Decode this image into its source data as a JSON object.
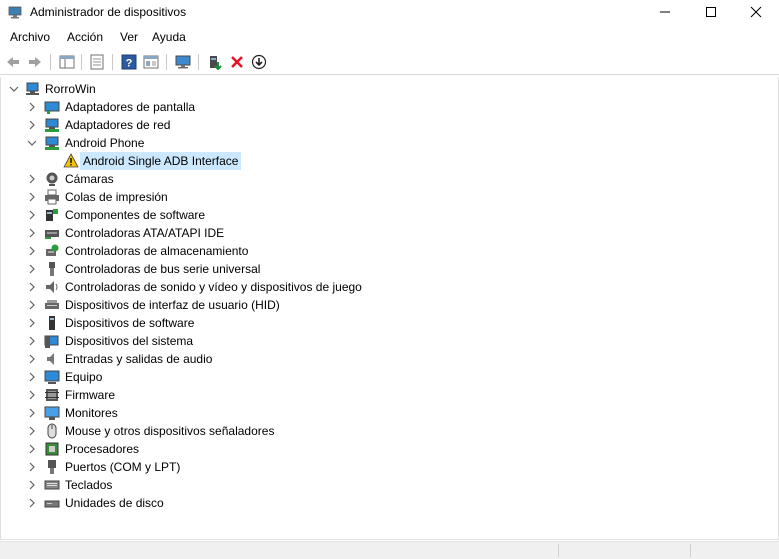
{
  "window": {
    "title": "Administrador de dispositivos"
  },
  "menu": [
    "Archivo",
    "Acción",
    "Ver",
    "Ayuda"
  ],
  "toolbar": {
    "icons": [
      "back-arrow-icon",
      "forward-arrow-icon",
      "properties-pane-icon",
      "properties-sheet-icon",
      "help-icon",
      "update-view-icon",
      "monitor-scan-icon",
      "add-driver-icon",
      "uninstall-x-icon",
      "download-driver-icon"
    ],
    "colors": {
      "uninstall": "#e81123",
      "add": "#1a8f3a"
    }
  },
  "tree": {
    "root": "RorroWin",
    "categories": [
      "Adaptadores de pantalla",
      "Adaptadores de red",
      "Android Phone",
      "Cámaras",
      "Colas de impresión",
      "Componentes de software",
      "Controladoras ATA/ATAPI IDE",
      "Controladoras de almacenamiento",
      "Controladoras de bus serie universal",
      "Controladoras de sonido y vídeo y dispositivos de juego",
      "Dispositivos de interfaz de usuario (HID)",
      "Dispositivos de software",
      "Dispositivos del sistema",
      "Entradas y salidas de audio",
      "Equipo",
      "Firmware",
      "Monitores",
      "Mouse y otros dispositivos señaladores",
      "Procesadores",
      "Puertos (COM y LPT)",
      "Teclados",
      "Unidades de disco"
    ],
    "android_child": "Android Single ADB Interface",
    "selection_color": "#cce8ff",
    "warning_color": "#f2c200"
  }
}
